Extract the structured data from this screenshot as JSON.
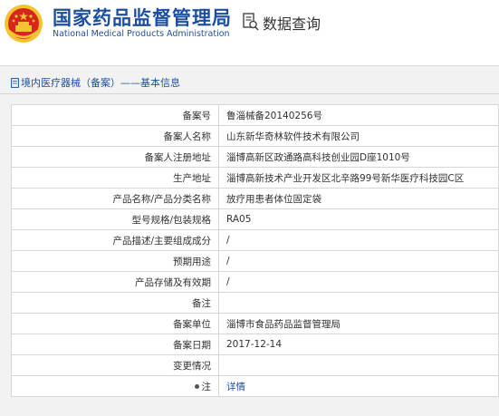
{
  "header": {
    "brand_cn": "国家药品监督管理局",
    "brand_en": "National Medical Products Administration",
    "query_title": "数据查询"
  },
  "section": {
    "title": "境内医疗器械（备案）——基本信息"
  },
  "rows": [
    {
      "label": "备案号",
      "value": "鲁淄械备20140256号"
    },
    {
      "label": "备案人名称",
      "value": "山东新华奇林软件技术有限公司"
    },
    {
      "label": "备案人注册地址",
      "value": "淄博高新区政通路高科技创业园D座1010号"
    },
    {
      "label": "生产地址",
      "value": "淄博高新技术产业开发区北辛路99号新华医疗科技园C区"
    },
    {
      "label": "产品名称/产品分类名称",
      "value": "放疗用患者体位固定袋"
    },
    {
      "label": "型号规格/包装规格",
      "value": "RA05"
    },
    {
      "label": "产品描述/主要组成成分",
      "value": "/"
    },
    {
      "label": "预期用途",
      "value": "/"
    },
    {
      "label": "产品存储及有效期",
      "value": "/"
    },
    {
      "label": "备注",
      "value": ""
    },
    {
      "label": "备案单位",
      "value": "淄博市食品药品监督管理局"
    },
    {
      "label": "备案日期",
      "value": "2017-12-14"
    },
    {
      "label": "变更情况",
      "value": ""
    }
  ],
  "note": {
    "label": "注",
    "link": "详情"
  },
  "colors": {
    "brand_blue": "#1d4f9f",
    "emblem_red": "#d7261e",
    "emblem_gold": "#f4c430"
  }
}
